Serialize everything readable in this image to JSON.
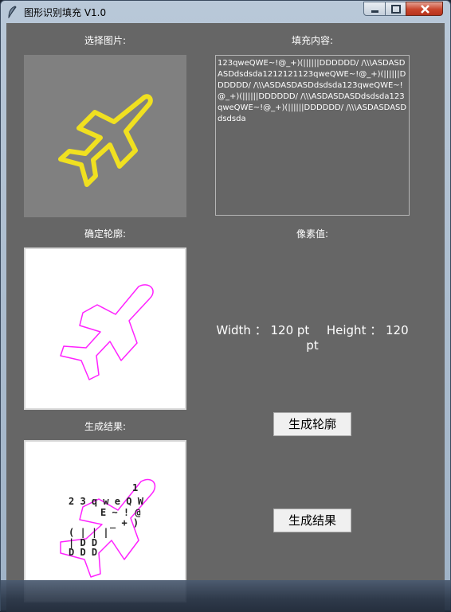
{
  "window": {
    "title": "图形识别填充 V1.0"
  },
  "labels": {
    "select_image": "选择图片:",
    "fill_content": "填充内容:",
    "contour": "确定轮廓:",
    "pixel_value": "像素值:",
    "result": "生成结果:"
  },
  "fill_text": "123qweQWE~!@_+)(||||||DDDDDD/ /\\\\\\ASDASDASDdsdsda1212121123qweQWE~!@_+)(||||||DDDDDD/ /\\\\\\ASDASDASDdsdsda123qweQWE~!@_+)(||||||DDDDDD/ /\\\\\\ASDASDASDdsdsda123qweQWE~!@_+)(||||||DDDDDD/ /\\\\\\ASDASDASDdsdsda",
  "dimensions": {
    "width_label": "Width ：",
    "width_value": "120 pt",
    "height_label": "Height ：",
    "height_value": "120 pt"
  },
  "buttons": {
    "generate_contour": "生成轮廓",
    "generate_result": "生成结果"
  },
  "icons": {
    "app": "feather-icon",
    "source_image": "airplane-icon"
  },
  "colors": {
    "panel_bg": "#666666",
    "plane_yellow": "#f0e020",
    "contour_magenta": "#ff22ff"
  }
}
